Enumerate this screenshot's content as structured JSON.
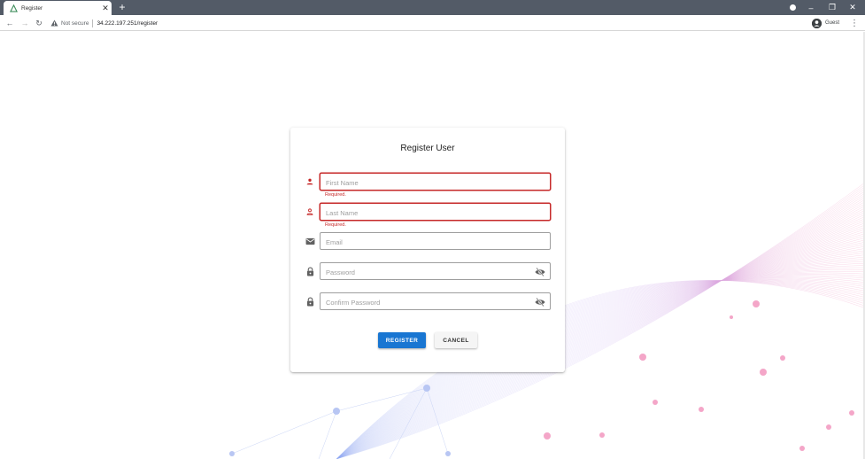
{
  "browser": {
    "tab_title": "Register",
    "new_tab_label": "+",
    "security_label": "Not secure",
    "url": "34.222.197.251/register",
    "profile_label": "Guest"
  },
  "form": {
    "title": "Register User",
    "first_name": {
      "placeholder": "First Name",
      "value": "",
      "error": "Required."
    },
    "last_name": {
      "placeholder": "Last Name",
      "value": "",
      "error": "Required."
    },
    "email": {
      "placeholder": "Email",
      "value": ""
    },
    "password": {
      "placeholder": "Password",
      "value": ""
    },
    "confirm_password": {
      "placeholder": "Confirm Password",
      "value": ""
    },
    "register_label": "REGISTER",
    "cancel_label": "CANCEL"
  },
  "icons": {
    "first_name": "person-icon",
    "last_name": "person-outline-icon",
    "email": "mail-icon",
    "password": "lock-icon",
    "confirm_password": "lock-icon",
    "password_toggle": "visibility-off-icon"
  },
  "colors": {
    "primary": "#1976d2",
    "error": "#c62828",
    "tabbar": "#535b67"
  }
}
